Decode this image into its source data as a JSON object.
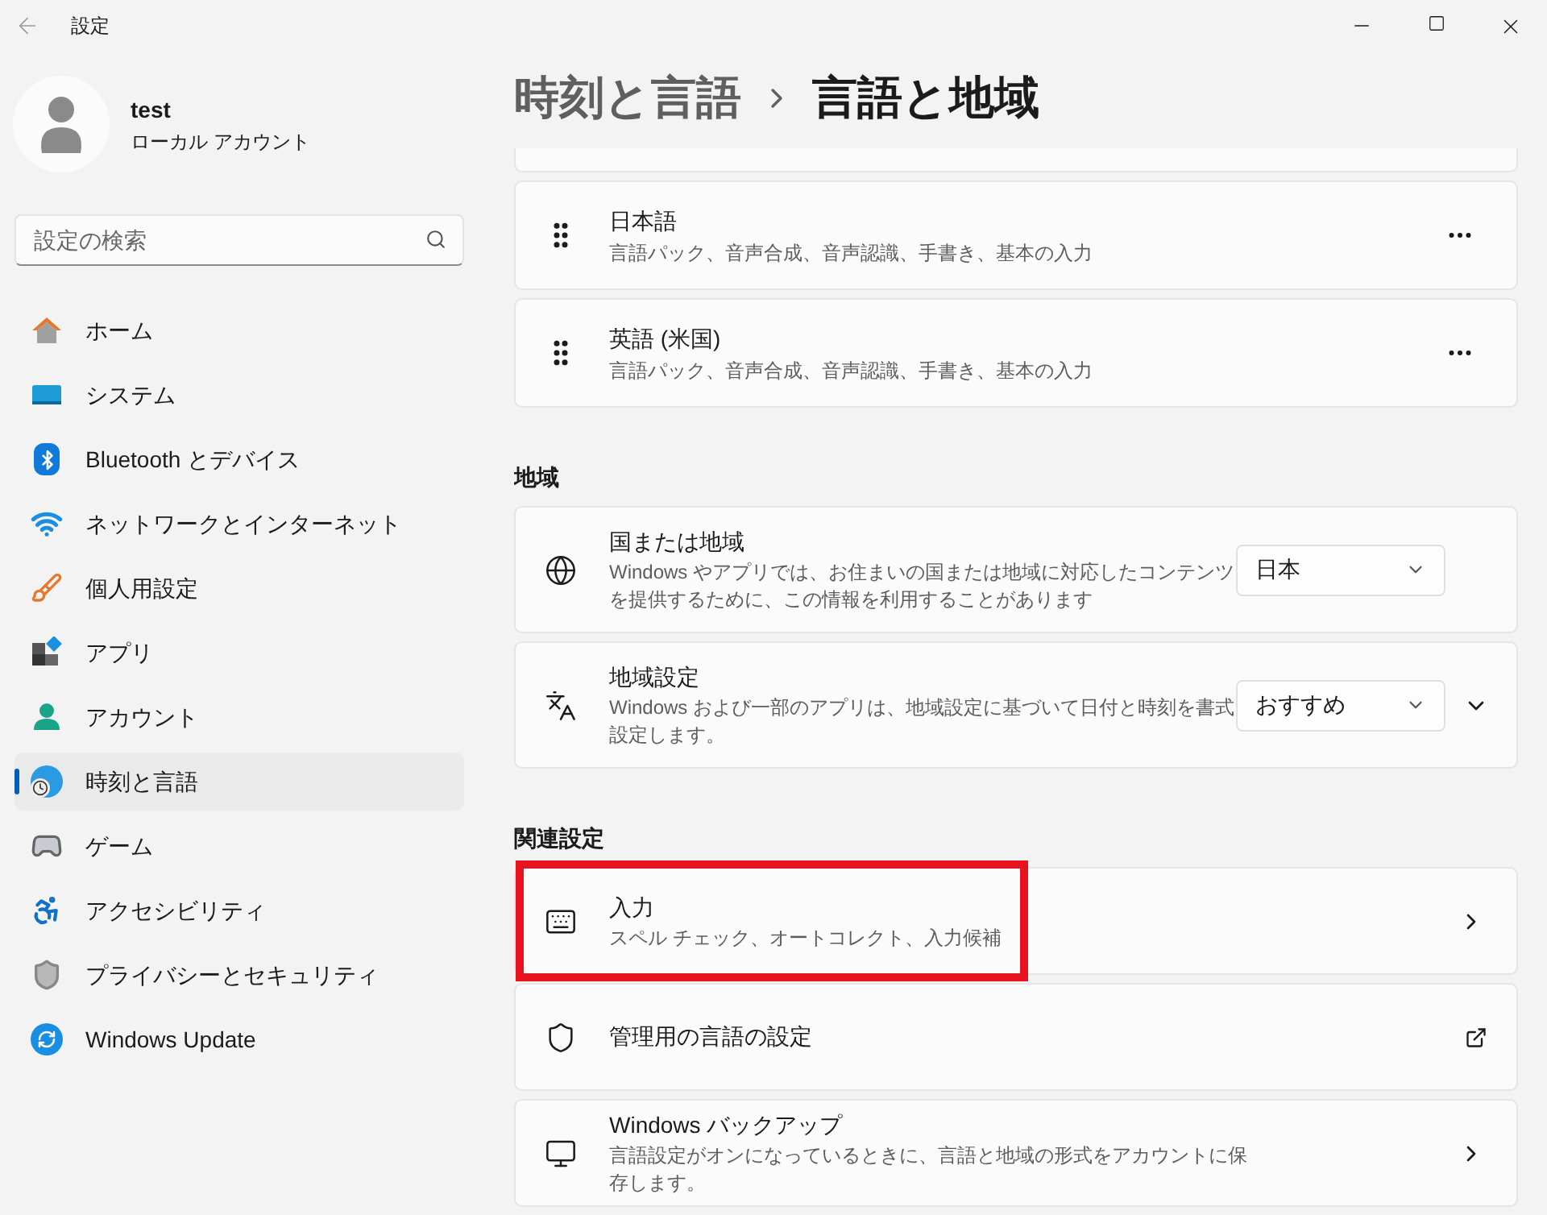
{
  "window": {
    "title": "設定"
  },
  "profile": {
    "name": "test",
    "account": "ローカル アカウント"
  },
  "search": {
    "placeholder": "設定の検索"
  },
  "nav": [
    {
      "label": "ホーム",
      "selected": false
    },
    {
      "label": "システム",
      "selected": false
    },
    {
      "label": "Bluetooth とデバイス",
      "selected": false
    },
    {
      "label": "ネットワークとインターネット",
      "selected": false
    },
    {
      "label": "個人用設定",
      "selected": false
    },
    {
      "label": "アプリ",
      "selected": false
    },
    {
      "label": "アカウント",
      "selected": false
    },
    {
      "label": "時刻と言語",
      "selected": true
    },
    {
      "label": "ゲーム",
      "selected": false
    },
    {
      "label": "アクセシビリティ",
      "selected": false
    },
    {
      "label": "プライバシーとセキュリティ",
      "selected": false
    },
    {
      "label": "Windows Update",
      "selected": false
    }
  ],
  "breadcrumb": {
    "parent": "時刻と言語",
    "current": "言語と地域"
  },
  "languages": [
    {
      "name": "日本語",
      "description": "言語パック、音声合成、音声認識、手書き、基本の入力"
    },
    {
      "name": "英語 (米国)",
      "description": "言語パック、音声合成、音声認識、手書き、基本の入力"
    }
  ],
  "sections": [
    {
      "heading": "地域",
      "items": [
        {
          "kind": "dropdown",
          "title": "国または地域",
          "description": "Windows やアプリでは、お住まいの国または地域に対応したコンテンツを提供するために、この情報を利用することがあります",
          "value": "日本",
          "expandable": false
        },
        {
          "kind": "dropdown",
          "title": "地域設定",
          "description": "Windows および一部のアプリは、地域設定に基づいて日付と時刻を書式設定します。",
          "value": "おすすめ",
          "expandable": true
        }
      ]
    },
    {
      "heading": "関連設定",
      "items": [
        {
          "kind": "link",
          "title": "入力",
          "description": "スペル チェック、オートコレクト、入力候補",
          "highlighted": true
        },
        {
          "kind": "external",
          "title": "管理用の言語の設定",
          "highlighted": false
        },
        {
          "kind": "link",
          "title": "Windows バックアップ",
          "description": "言語設定がオンになっているときに、言語と地域の形式をアカウントに保存します。",
          "highlighted": false
        }
      ]
    }
  ]
}
